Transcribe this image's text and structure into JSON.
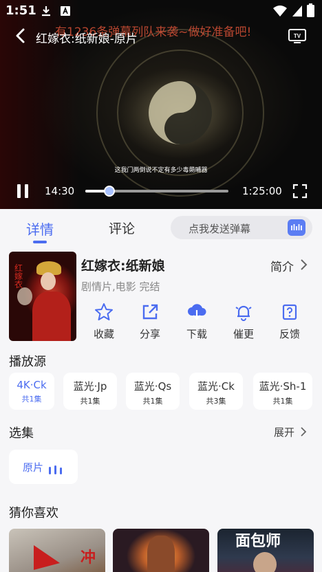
{
  "status_bar": {
    "time": "1:51"
  },
  "player": {
    "title": "红嫁衣:纸新娘-原片",
    "danmaku_notice": "有1236条弹幕列队来袭~做好准备吧!",
    "subtitle": "这我门两倒说不定有多少毒蒴晡器",
    "current_time": "14:30",
    "duration": "1:25:00",
    "progress": 0.17,
    "state": "playing"
  },
  "tabs": [
    {
      "label": "详情",
      "active": true
    },
    {
      "label": "评论",
      "active": false
    }
  ],
  "danmaku_input": {
    "placeholder": "点我发送弹幕"
  },
  "movie": {
    "poster_text": "红嫁衣",
    "title": "红嫁衣:纸新娘",
    "intro_label": "简介",
    "meta": "剧情片,电影 完结"
  },
  "actions": [
    {
      "label": "收藏",
      "icon": "star-icon"
    },
    {
      "label": "分享",
      "icon": "share-icon"
    },
    {
      "label": "下载",
      "icon": "download-icon"
    },
    {
      "label": "催更",
      "icon": "bell-icon"
    },
    {
      "label": "反馈",
      "icon": "feedback-icon"
    }
  ],
  "sources_title": "播放源",
  "sources": [
    {
      "name": "4K·Ck",
      "count": "共1集",
      "active": true
    },
    {
      "name": "蓝光·Jp",
      "count": "共1集",
      "active": false
    },
    {
      "name": "蓝光·Qs",
      "count": "共1集",
      "active": false
    },
    {
      "name": "蓝光·Ck",
      "count": "共3集",
      "active": false
    },
    {
      "name": "蓝光·Sh-1",
      "count": "共1集",
      "active": false
    }
  ],
  "episodes_title": "选集",
  "expand_label": "展开",
  "episodes": [
    {
      "label": "原片",
      "active": true
    }
  ],
  "recommend_title": "猜你喜欢",
  "recommendations": [
    {
      "poster_text": "冲"
    },
    {
      "poster_text": ""
    },
    {
      "poster_text": "面包师"
    }
  ],
  "colors": {
    "accent": "#4b6cf0",
    "page_bg": "#f6f6f8",
    "card_bg": "#ffffff"
  }
}
